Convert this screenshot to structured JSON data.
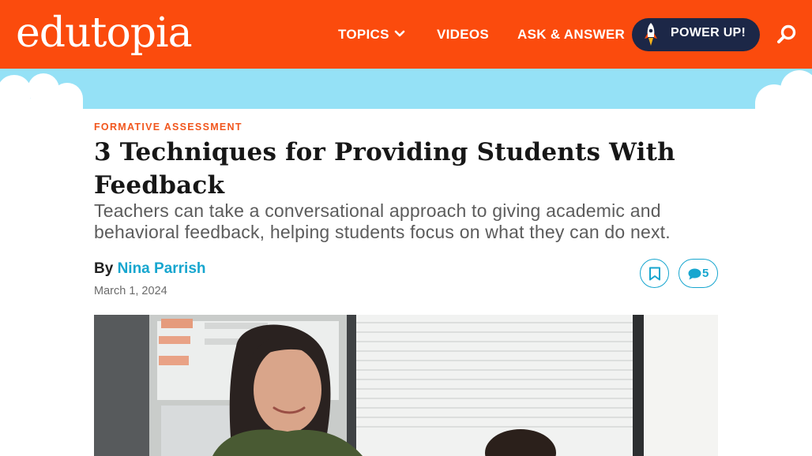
{
  "header": {
    "logo_text": "edutopia",
    "nav": {
      "topics": "TOPICS",
      "videos": "VIDEOS",
      "ask": "ASK & ANSWER"
    },
    "power_up": "POWER UP!",
    "icons": [
      "chevron-down-icon",
      "rocket-icon",
      "search-icon"
    ]
  },
  "colors": {
    "header_bg": "#fb4b0d",
    "sky": "#95e1f6",
    "button_dark": "#1c2747",
    "accent_blue": "#17a6cf",
    "kicker": "#f1561d"
  },
  "article": {
    "category": "FORMATIVE ASSESSMENT",
    "title": "3 Techniques for Providing Students With Feedback",
    "dek": "Teachers can take a conversational approach to giving academic and behavioral feedback, helping students focus on what they can do next.",
    "by": "By",
    "author": "Nina Parrish",
    "date": "March 1, 2024",
    "comment_count": "5"
  }
}
